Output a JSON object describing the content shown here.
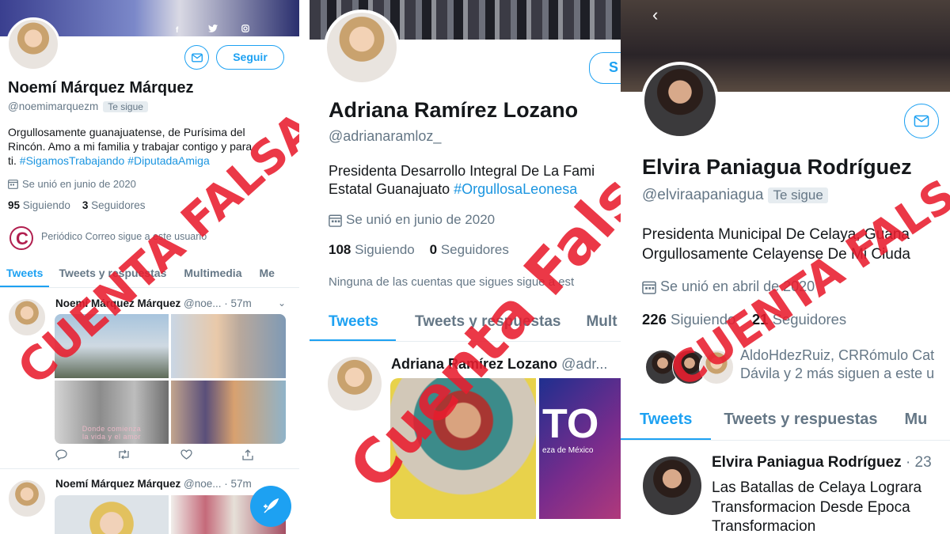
{
  "panels": {
    "p1": {
      "name": "Noemí Márquez Márquez",
      "handle": "@noemimarquezm",
      "follows_badge": "Te sigue",
      "follow_button": "Seguir",
      "bio_lines": [
        "Orgullosamente guanajuatense, de Purísima del",
        "Rincón. Amo a mi familia y trabajar contigo y para",
        "ti."
      ],
      "hashtags": "#SigamosTrabajando #DiputadaAmiga",
      "joined": "Se unió en junio de 2020",
      "following_count": "95",
      "following_label": "Siguiendo",
      "followers_count": "3",
      "followers_label": "Seguidores",
      "followed_by": "Periódico Correo sigue a este usuario",
      "tabs": [
        "Tweets",
        "Tweets y respuestas",
        "Multimedia",
        "Me"
      ],
      "tweets": [
        {
          "name": "Noemí Márquez Márquez",
          "handle": "@noe...",
          "time": "· 57m"
        },
        {
          "name": "Noemí Márquez Márquez",
          "handle": "@noe...",
          "time": "· 57m"
        }
      ],
      "image_caption_1": "Donde comienza",
      "image_caption_2": "la vida y el amor",
      "stamp": "CUENTA FALSA"
    },
    "p2": {
      "name": "Adriana Ramírez Lozano",
      "handle": "@adrianaramloz_",
      "follow_button": "S",
      "bio_line_1": "Presidenta Desarrollo Integral De La Fami",
      "bio_line_2_prefix": "Estatal Guanajuato",
      "bio_line_2_tag": "#OrgullosaLeonesa",
      "joined": "Se unió en junio de 2020",
      "following_count": "108",
      "following_label": "Siguiendo",
      "followers_count": "0",
      "followers_label": "Seguidores",
      "no_followers_note": "Ninguna de las cuentas que sigues sigue a est",
      "tabs": [
        "Tweets",
        "Tweets y respuestas",
        "Mult"
      ],
      "tweet": {
        "name": "Adriana Ramírez Lozano",
        "handle": "@adr..."
      },
      "media_text": "TO",
      "media_subtext": "eza de México",
      "stamp": "Cuenta Falsa"
    },
    "p3": {
      "name": "Elvira Paniagua Rodríguez",
      "handle": "@elviraapaniagua",
      "follows_badge": "Te sigue",
      "bio_line_1": "Presidenta Municipal De Celaya, Guana",
      "bio_line_2": "Orgullosamente Celayense De Mi Ciuda",
      "joined": "Se unió en abril de 2020",
      "following_count": "226",
      "following_label": "Siguiendo",
      "followers_count": "21",
      "followers_label": "Seguidores",
      "followed_by_line_1": "AldoHdezRuiz, CRRómulo Cat",
      "followed_by_line_2": "Dávila y 2 más siguen a este u",
      "tabs": [
        "Tweets",
        "Tweets y respuestas",
        "Mu"
      ],
      "tweet": {
        "name": "Elvira Paniagua Rodríguez",
        "time": "· 23",
        "lines": [
          "Las Batallas de Celaya Lograra",
          "Transformacion Desde Epoca",
          "Transformacion"
        ]
      },
      "stamp": "CUENTA FALSA"
    }
  },
  "colors": {
    "twitter_blue": "#1da1f2",
    "stamp_red": "#e81c2e",
    "muted_text": "#657786"
  },
  "icons": [
    "facebook-icon",
    "twitter-icon",
    "instagram-icon",
    "mail-icon",
    "calendar-icon",
    "back-chevron-icon",
    "reply-icon",
    "retweet-icon",
    "like-icon",
    "share-icon",
    "compose-icon"
  ]
}
